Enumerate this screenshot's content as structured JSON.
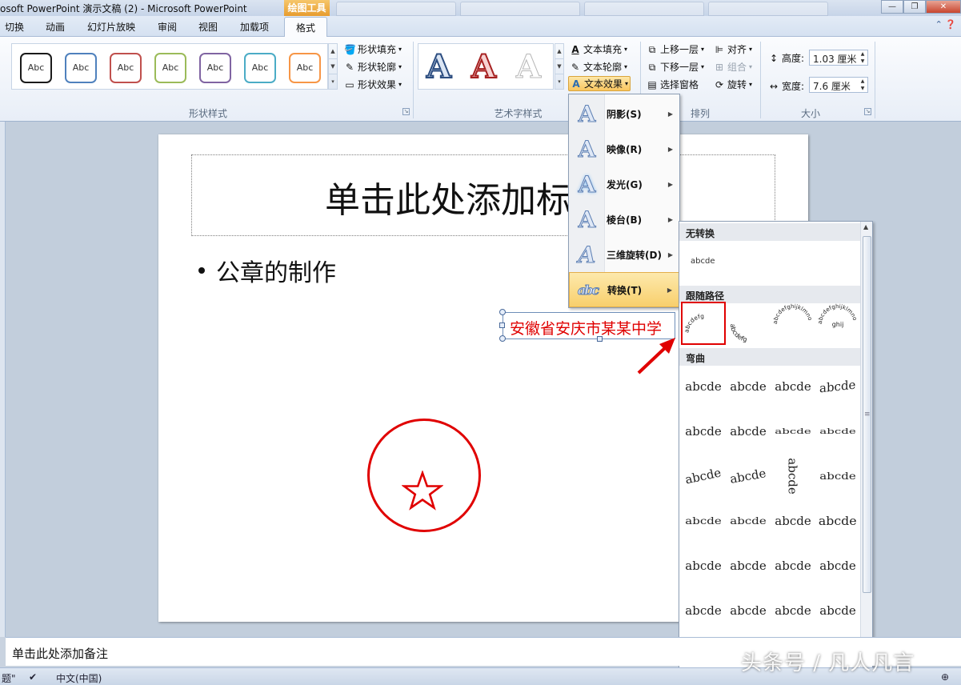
{
  "window": {
    "title": "osoft PowerPoint 演示文稿 (2)  -  Microsoft PowerPoint",
    "context_tab_group": "绘图工具"
  },
  "tabs": [
    {
      "label": "切换"
    },
    {
      "label": "动画"
    },
    {
      "label": "幻灯片放映"
    },
    {
      "label": "审阅"
    },
    {
      "label": "视图"
    },
    {
      "label": "加载项"
    },
    {
      "label": "格式",
      "active": true
    }
  ],
  "ribbon": {
    "shape_styles": {
      "label": "形状样式",
      "gallery": [
        {
          "text": "Abc",
          "color": "#1a1a1a"
        },
        {
          "text": "Abc",
          "color": "#4f81bd"
        },
        {
          "text": "Abc",
          "color": "#c0504d"
        },
        {
          "text": "Abc",
          "color": "#9bbb59"
        },
        {
          "text": "Abc",
          "color": "#8064a2"
        },
        {
          "text": "Abc",
          "color": "#4bacc6"
        },
        {
          "text": "Abc",
          "color": "#f79646"
        }
      ],
      "fill": "形状填充",
      "outline": "形状轮廓",
      "effects": "形状效果"
    },
    "wordart": {
      "label": "艺术字样式",
      "samples": [
        {
          "letter": "A",
          "style": "outline-blue"
        },
        {
          "letter": "A",
          "style": "outline-red"
        },
        {
          "letter": "A",
          "style": "outline-light"
        }
      ],
      "text_fill": "文本填充",
      "text_outline": "文本轮廓",
      "text_effects": "文本效果"
    },
    "arrange": {
      "label": "排列",
      "bring_forward": "上移一层",
      "send_backward": "下移一层",
      "selection_pane": "选择窗格",
      "align": "对齐",
      "group": "组合",
      "rotate": "旋转"
    },
    "size": {
      "label": "大小",
      "height_label": "高度:",
      "height_value": "1.03 厘米",
      "width_label": "宽度:",
      "width_value": "7.6 厘米"
    }
  },
  "slide": {
    "title_placeholder": "单击此处添加标",
    "bullet": "公章的制作",
    "seal_text": "安徽省安庆市某某中学",
    "seal_star": "☆",
    "seal_color": "#e00000"
  },
  "text_effects_menu": {
    "items": [
      {
        "label": "阴影(S)"
      },
      {
        "label": "映像(R)"
      },
      {
        "label": "发光(G)"
      },
      {
        "label": "棱台(B)"
      },
      {
        "label": "三维旋转(D)"
      },
      {
        "label": "转换(T)",
        "active": true
      }
    ]
  },
  "transform_menu": {
    "no_transform_header": "无转换",
    "no_transform_sample": "abcde",
    "follow_path_header": "跟随路径",
    "warp_header": "弯曲",
    "warp_sample": "abcde",
    "warp_rows": 7,
    "warp_cols": 4
  },
  "notes": {
    "placeholder": "单击此处添加备注"
  },
  "statusbar": {
    "language": "中文(中国)"
  },
  "watermark": "头条号 / 凡人凡言"
}
